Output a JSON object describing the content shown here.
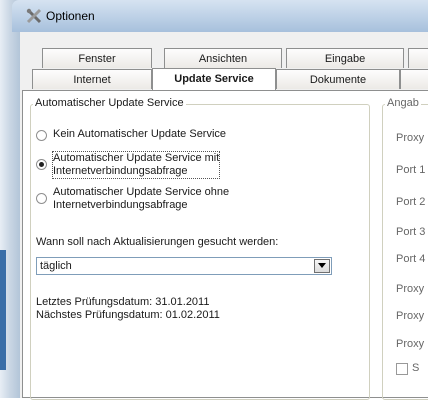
{
  "window": {
    "title": "Optionen",
    "icon": "wrench-cross-icon"
  },
  "tabs_row1": [
    {
      "label": "Fenster"
    },
    {
      "label": "Ansichten"
    },
    {
      "label": "Eingabe"
    },
    {
      "label": ""
    }
  ],
  "tabs_row2": [
    {
      "label": "Internet"
    },
    {
      "label": "Update Service",
      "active": true
    },
    {
      "label": "Dokumente"
    },
    {
      "label": ""
    }
  ],
  "update_group": {
    "legend": "Automatischer Update Service",
    "options": [
      {
        "label": "Kein Automatischer Update Service",
        "checked": false
      },
      {
        "line1": "Automatischer Update Service mit",
        "line2": "Internetverbindungsabfrage",
        "checked": true
      },
      {
        "line1": "Automatischer Update Service ohne",
        "line2": "Internetverbindungsabfrage",
        "checked": false
      }
    ],
    "interval_question": "Wann soll nach Aktualisierungen gesucht werden:",
    "interval_value": "täglich",
    "last_check": "Letztes Prüfungsdatum: 31.01.2011",
    "next_check": "Nächstes Prüfungsdatum: 01.02.2011"
  },
  "right_group": {
    "legend": "Angab",
    "labels": [
      "Proxy",
      "Port 1",
      "Port 2",
      "Port 3",
      "Port 4",
      "Proxy",
      "Proxy",
      "Proxy"
    ],
    "checkbox_label": "S"
  },
  "colors": {
    "active_radio": "#222222",
    "border": "#8e8f8f",
    "titlebar": "#bcd0e6"
  }
}
